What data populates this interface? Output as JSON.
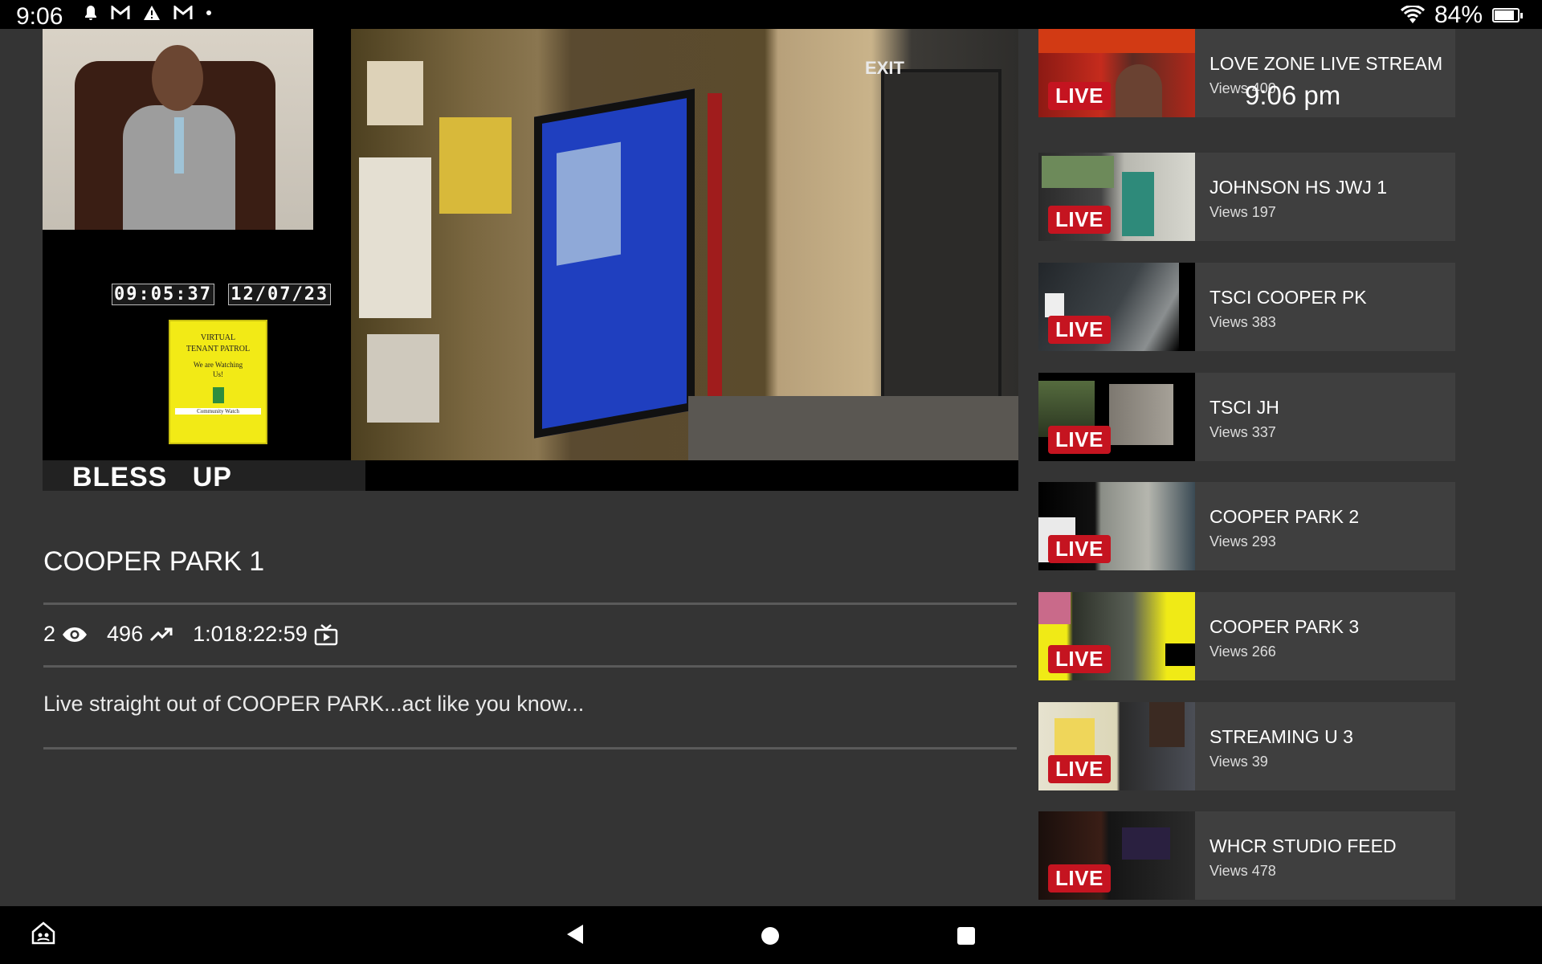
{
  "status_bar": {
    "time": "9:06",
    "battery": "84%",
    "battery_level": 0.84,
    "notification_icons": [
      "bell-icon",
      "gmail-icon",
      "warning-icon",
      "gmail-icon",
      "dot-icon"
    ]
  },
  "player": {
    "ticker": "BLESS   UP",
    "timestamp_time": "09:05:37",
    "timestamp_date": "12/07/23",
    "poster_line1": "VIRTUAL",
    "poster_line2": "TENANT PATROL",
    "poster_line3": "We are Watching",
    "poster_line4": "Us!",
    "poster_line5": "Community Watch",
    "exit_sign": "EXIT"
  },
  "video": {
    "title": "COOPER PARK 1",
    "watching_count": "2",
    "total_views": "496",
    "duration": "1:018:22:59",
    "description": "Live straight out of COOPER PARK...act like you know..."
  },
  "floating_clock": "9:06 pm",
  "live_badge": "LIVE",
  "streams": [
    {
      "title": "LOVE ZONE LIVE STREAM",
      "views": "Views 400"
    },
    {
      "title": "JOHNSON HS JWJ 1",
      "views": "Views 197"
    },
    {
      "title": "TSCI COOPER PK",
      "views": "Views 383"
    },
    {
      "title": "TSCI JH",
      "views": "Views 337"
    },
    {
      "title": "COOPER PARK 2",
      "views": "Views 293"
    },
    {
      "title": "COOPER PARK 3",
      "views": "Views 266"
    },
    {
      "title": "STREAMING U 3",
      "views": "Views 39"
    },
    {
      "title": "WHCR STUDIO FEED",
      "views": "Views 478"
    }
  ]
}
